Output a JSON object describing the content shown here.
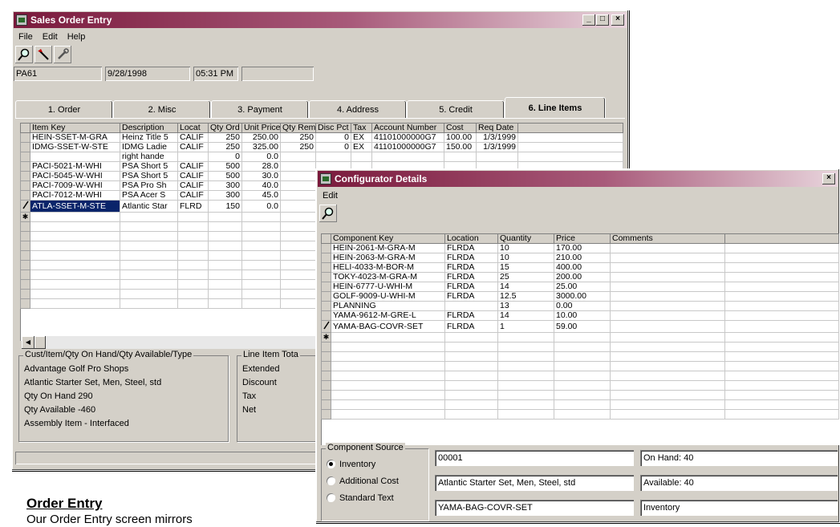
{
  "order_window": {
    "title": "Sales Order Entry",
    "menu": [
      "File",
      "Edit",
      "Help"
    ],
    "status": {
      "order_no": "PA61",
      "date": "9/28/1998",
      "time": "05:31 PM"
    },
    "tabs": [
      "1. Order",
      "2. Misc",
      "3. Payment",
      "4. Address",
      "5. Credit",
      "6. Line Items"
    ],
    "active_tab": "6. Line Items",
    "columns": [
      "Item Key",
      "Description",
      "Locat",
      "Qty Ord",
      "Unit Price",
      "Qty Rem",
      "Disc Pct",
      "Tax",
      "Account Number",
      "Cost",
      "Req Date"
    ],
    "rows": [
      {
        "marker": "",
        "cells": [
          "HEIN-SSET-M-GRA",
          "Heinz Title 5",
          "CALIF",
          "250",
          "250.00",
          "250",
          "0",
          "EX",
          "41101000000G7",
          "100.00",
          "1/3/1999"
        ]
      },
      {
        "marker": "",
        "cells": [
          "IDMG-SSET-W-STE",
          "IDMG Ladie",
          "CALIF",
          "250",
          "325.00",
          "250",
          "0",
          "EX",
          "41101000000G7",
          "150.00",
          "1/3/1999"
        ]
      },
      {
        "marker": "",
        "cells": [
          "",
          "right hande",
          "",
          "0",
          "0.0",
          "",
          "",
          "",
          "",
          "",
          ""
        ]
      },
      {
        "marker": "",
        "cells": [
          "PACI-5021-M-WHI",
          "PSA Short 5",
          "CALIF",
          "500",
          "28.0",
          "",
          "",
          "",
          "",
          "",
          ""
        ]
      },
      {
        "marker": "",
        "cells": [
          "PACI-5045-W-WHI",
          "PSA Short 5",
          "CALIF",
          "500",
          "30.0",
          "",
          "",
          "",
          "",
          "",
          ""
        ]
      },
      {
        "marker": "",
        "cells": [
          "PACI-7009-W-WHI",
          "PSA Pro Sh",
          "CALIF",
          "300",
          "40.0",
          "",
          "",
          "",
          "",
          "",
          ""
        ]
      },
      {
        "marker": "",
        "cells": [
          "PACI-7012-M-WHI",
          "PSA Acer S",
          "CALIF",
          "300",
          "45.0",
          "",
          "",
          "",
          "",
          "",
          ""
        ]
      },
      {
        "marker": "pencil",
        "cells": [
          "ATLA-SSET-M-STE",
          "Atlantic Star",
          "FLRD",
          "150",
          "0.0",
          "",
          "",
          "",
          "",
          "",
          ""
        ]
      },
      {
        "marker": "*",
        "cells": [
          "",
          "",
          "",
          "",
          "",
          "",
          "",
          "",
          "",
          "",
          ""
        ]
      }
    ],
    "info_group": {
      "title": "Cust/Item/Qty On Hand/Qty Available/Type",
      "lines": [
        "Advantage Golf Pro Shops",
        "Atlantic Starter Set, Men, Steel, std",
        "Qty On Hand  290",
        "Qty Available  -460",
        "Assembly Item - Interfaced"
      ]
    },
    "totals_group": {
      "title": "Line Item Tota",
      "labels": [
        "Extended",
        "Discount",
        "Tax",
        "Net"
      ]
    }
  },
  "config_window": {
    "title": "Configurator Details",
    "menu": [
      "Edit"
    ],
    "columns": [
      "Component Key",
      "Location",
      "Quantity",
      "Price",
      "Comments"
    ],
    "rows": [
      {
        "marker": "",
        "cells": [
          "HEIN-2061-M-GRA-M",
          "FLRDA",
          "10",
          "170.00",
          ""
        ]
      },
      {
        "marker": "",
        "cells": [
          "HEIN-2063-M-GRA-M",
          "FLRDA",
          "10",
          "210.00",
          ""
        ]
      },
      {
        "marker": "",
        "cells": [
          "HELI-4033-M-BOR-M",
          "FLRDA",
          "15",
          "400.00",
          ""
        ]
      },
      {
        "marker": "",
        "cells": [
          "TOKY-4023-M-GRA-M",
          "FLRDA",
          "25",
          "200.00",
          ""
        ]
      },
      {
        "marker": "",
        "cells": [
          "HEIN-6777-U-WHI-M",
          "FLRDA",
          "14",
          "25.00",
          ""
        ]
      },
      {
        "marker": "",
        "cells": [
          "GOLF-9009-U-WHI-M",
          "FLRDA",
          "12.5",
          "3000.00",
          ""
        ]
      },
      {
        "marker": "",
        "cells": [
          "PLANNING",
          "",
          "13",
          "0.00",
          ""
        ]
      },
      {
        "marker": "",
        "cells": [
          "YAMA-9612-M-GRE-L",
          "FLRDA",
          "14",
          "10.00",
          ""
        ]
      },
      {
        "marker": "pencil",
        "cells": [
          "YAMA-BAG-COVR-SET",
          "FLRDA",
          "1",
          "59.00",
          ""
        ]
      },
      {
        "marker": "*",
        "cells": [
          "",
          "",
          "",
          "",
          ""
        ]
      }
    ],
    "source_group": {
      "title": "Component Source",
      "options": [
        "Inventory",
        "Additional Cost",
        "Standard Text"
      ],
      "selected": 0
    },
    "fields": {
      "code": "00001",
      "description": "Atlantic Starter Set, Men, Steel, std",
      "text": "YAMA-BAG-COVR-SET",
      "on_hand": "On Hand: 40",
      "available": "Available: 40",
      "type": "Inventory"
    }
  },
  "caption": {
    "heading": "Order Entry",
    "body": "Our Order Entry screen mirrors"
  }
}
